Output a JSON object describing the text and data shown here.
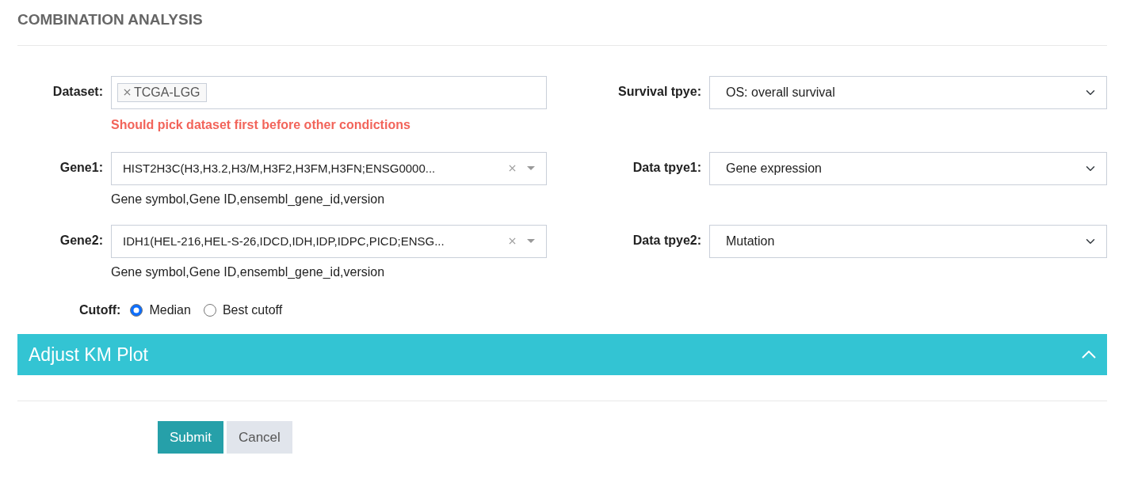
{
  "title": "COMBINATION ANALYSIS",
  "dataset": {
    "label": "Dataset:",
    "tags": [
      "TCGA-LGG"
    ],
    "warning": "Should pick dataset first before other condictions"
  },
  "survival_type": {
    "label": "Survival tpye:",
    "value": "OS: overall survival"
  },
  "genes": [
    {
      "label": "Gene1:",
      "value": "HIST2H3C(H3,H3.2,H3/M,H3F2,H3FM,H3FN;ENSG0000...",
      "help": "Gene symbol,Gene ID,ensembl_gene_id,version"
    },
    {
      "label": "Gene2:",
      "value": "IDH1(HEL-216,HEL-S-26,IDCD,IDH,IDP,IDPC,PICD;ENSG...",
      "help": "Gene symbol,Gene ID,ensembl_gene_id,version"
    }
  ],
  "data_types": [
    {
      "label": "Data tpye1:",
      "value": "Gene expression"
    },
    {
      "label": "Data tpye2:",
      "value": "Mutation"
    }
  ],
  "cutoff": {
    "label": "Cutoff:",
    "options": [
      {
        "label": "Median",
        "selected": true
      },
      {
        "label": "Best cutoff",
        "selected": false
      }
    ]
  },
  "panel": {
    "title": "Adjust KM Plot",
    "expanded": true
  },
  "buttons": [
    {
      "label": "Submit",
      "kind": "primary"
    },
    {
      "label": "Cancel",
      "kind": "secondary"
    }
  ]
}
